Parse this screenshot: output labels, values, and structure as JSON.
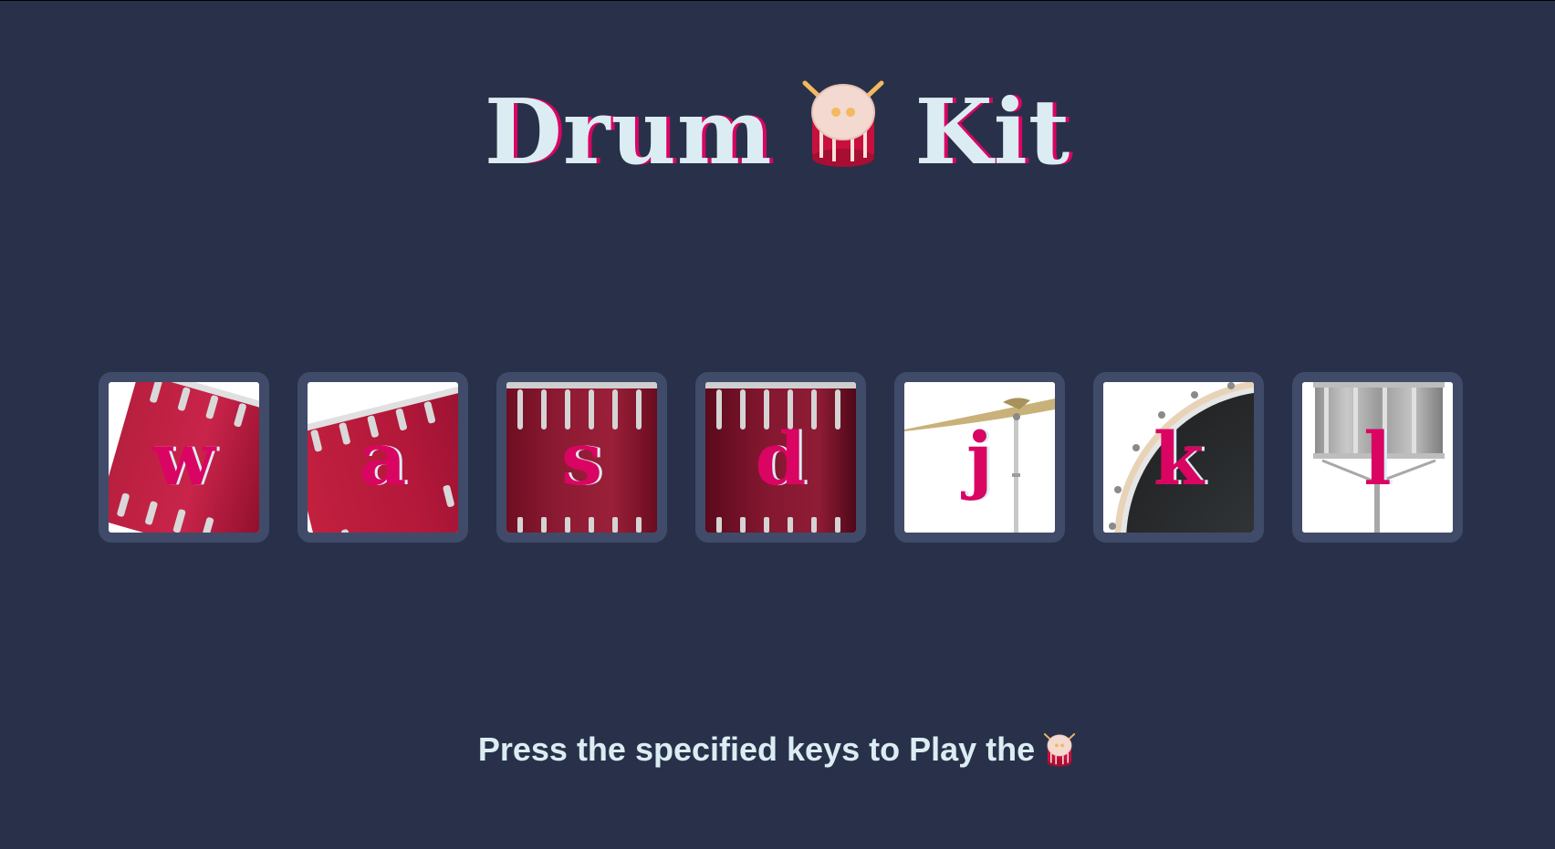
{
  "header": {
    "title_left": "Drum",
    "title_right": "Kit",
    "title_icon": "drum-emoji-icon"
  },
  "pads": [
    {
      "key": "w",
      "icon": "tom-1-icon"
    },
    {
      "key": "a",
      "icon": "tom-2-icon"
    },
    {
      "key": "s",
      "icon": "tom-3-icon"
    },
    {
      "key": "d",
      "icon": "tom-4-icon"
    },
    {
      "key": "j",
      "icon": "crash-cymbal-icon"
    },
    {
      "key": "k",
      "icon": "kick-bass-icon"
    },
    {
      "key": "l",
      "icon": "snare-icon"
    }
  ],
  "footer": {
    "text": "Press the specified keys to Play the",
    "icon": "drum-emoji-icon"
  },
  "colors": {
    "background": "#283149",
    "pad_border": "#404B69",
    "accent": "#DA0463",
    "text": "#DBEDF3"
  }
}
